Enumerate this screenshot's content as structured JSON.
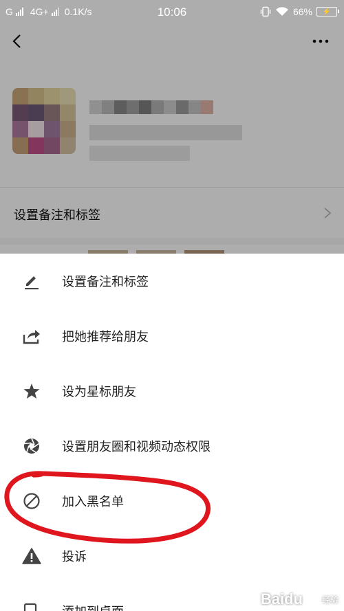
{
  "status_bar": {
    "carrier_left": "G",
    "network": "4G+",
    "speed": "0.1K/s",
    "time": "10:06",
    "battery_percent": "66%",
    "icons": [
      "signal-icon",
      "signal-icon",
      "vibrate-icon",
      "wifi-icon",
      "battery-charging-icon"
    ]
  },
  "header": {
    "back_icon": "chevron-left-icon",
    "more_icon": "more-dots-icon"
  },
  "profile": {
    "remark_row_label": "设置备注和标签"
  },
  "menu": {
    "items": [
      {
        "icon": "pencil-icon",
        "label": "设置备注和标签"
      },
      {
        "icon": "share-icon",
        "label": "把她推荐给朋友"
      },
      {
        "icon": "star-icon",
        "label": "设为星标朋友"
      },
      {
        "icon": "aperture-icon",
        "label": "设置朋友圈和视频动态权限"
      },
      {
        "icon": "block-icon",
        "label": "加入黑名单"
      },
      {
        "icon": "warning-icon",
        "label": "投诉"
      },
      {
        "icon": "add-to-desktop-icon",
        "label": "添加到桌面"
      }
    ]
  },
  "annotation": {
    "color": "#e0161e"
  },
  "watermark": {
    "brand": "Baidu",
    "sub": "经验",
    "color": "#ffffff"
  },
  "colors": {
    "icon": "#444444",
    "text": "#222222",
    "overlay": "rgba(0,0,0,0.32)"
  }
}
